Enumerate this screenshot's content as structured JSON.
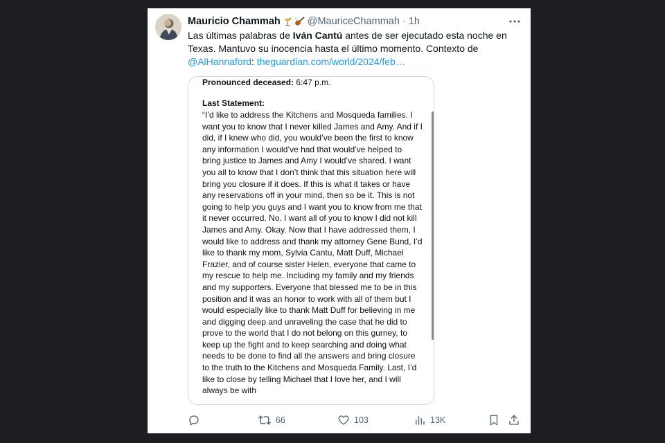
{
  "tweet": {
    "author": {
      "display_name": "Mauricio Chammah",
      "handle": "@MauriceChammah",
      "separator": "·",
      "time": "1h",
      "emoji": "🍹🎻"
    },
    "text": {
      "part1": "Las últimas palabras de ",
      "bold_name": "Iván Cantú",
      "part2": " antes de ser ejecutado esta noche en Texas. Mantuvo su inocencia hasta el último momento. Contexto de ",
      "mention": "@AlHannaford",
      "part3": ": ",
      "link": "theguardian.com/world/2024/feb…"
    },
    "document": {
      "pronounced_label": "Pronounced deceased:",
      "pronounced_value": "6:47 p.m.",
      "statement_label": "Last Statement:",
      "statement_text": "“I’d like to address the Kitchens and Mosqueda families. I want you to know that I never killed James and Amy. And if I did, if I knew who did, you would’ve been the first to know any information I would’ve had that would’ve helped to bring justice to James and Amy I would’ve shared. I want you all to know that I don’t think that this situation here will bring you closure if it does. If this is what it takes or have any reservations off in your mind, then so be it. This is not going to help you guys and I want you to know from me that it never occurred. No. I want all of you to know I did not kill James and Amy. Okay.  Now that I have addressed them, I would like to address and thank my attorney Gene Bund, I’d like to thank my mom, Sylvia Cantu, Matt Duff, Michael Frazier, and of course sister Helen, everyone that came to my rescue to help me. Including my family and my friends and my supporters. Everyone that blessed me to be in this position and it was an honor to work with all of them but I would especially like to thank Matt Duff for believing in me and digging deep and unraveling the case that he did to prove to the world that I do not belong on this gurney, to keep up the fight and to keep searching and doing what needs to be done to find all the answers and bring closure to the truth to the Kitchens and Mosqueda Family. Last, I’d like to close by telling Michael that I love her, and I will always be with"
    },
    "actions": {
      "reply_count": "",
      "retweet_count": "66",
      "like_count": "103",
      "views_count": "13K"
    },
    "icons": {
      "more": "more-icon",
      "reply": "reply-icon",
      "retweet": "retweet-icon",
      "like": "heart-icon",
      "views": "views-icon",
      "bookmark": "bookmark-icon",
      "share": "share-icon"
    },
    "colors": {
      "link": "#1d9bf0",
      "text": "#0f1419",
      "secondary": "#536471",
      "background": "#1d1e21"
    }
  }
}
